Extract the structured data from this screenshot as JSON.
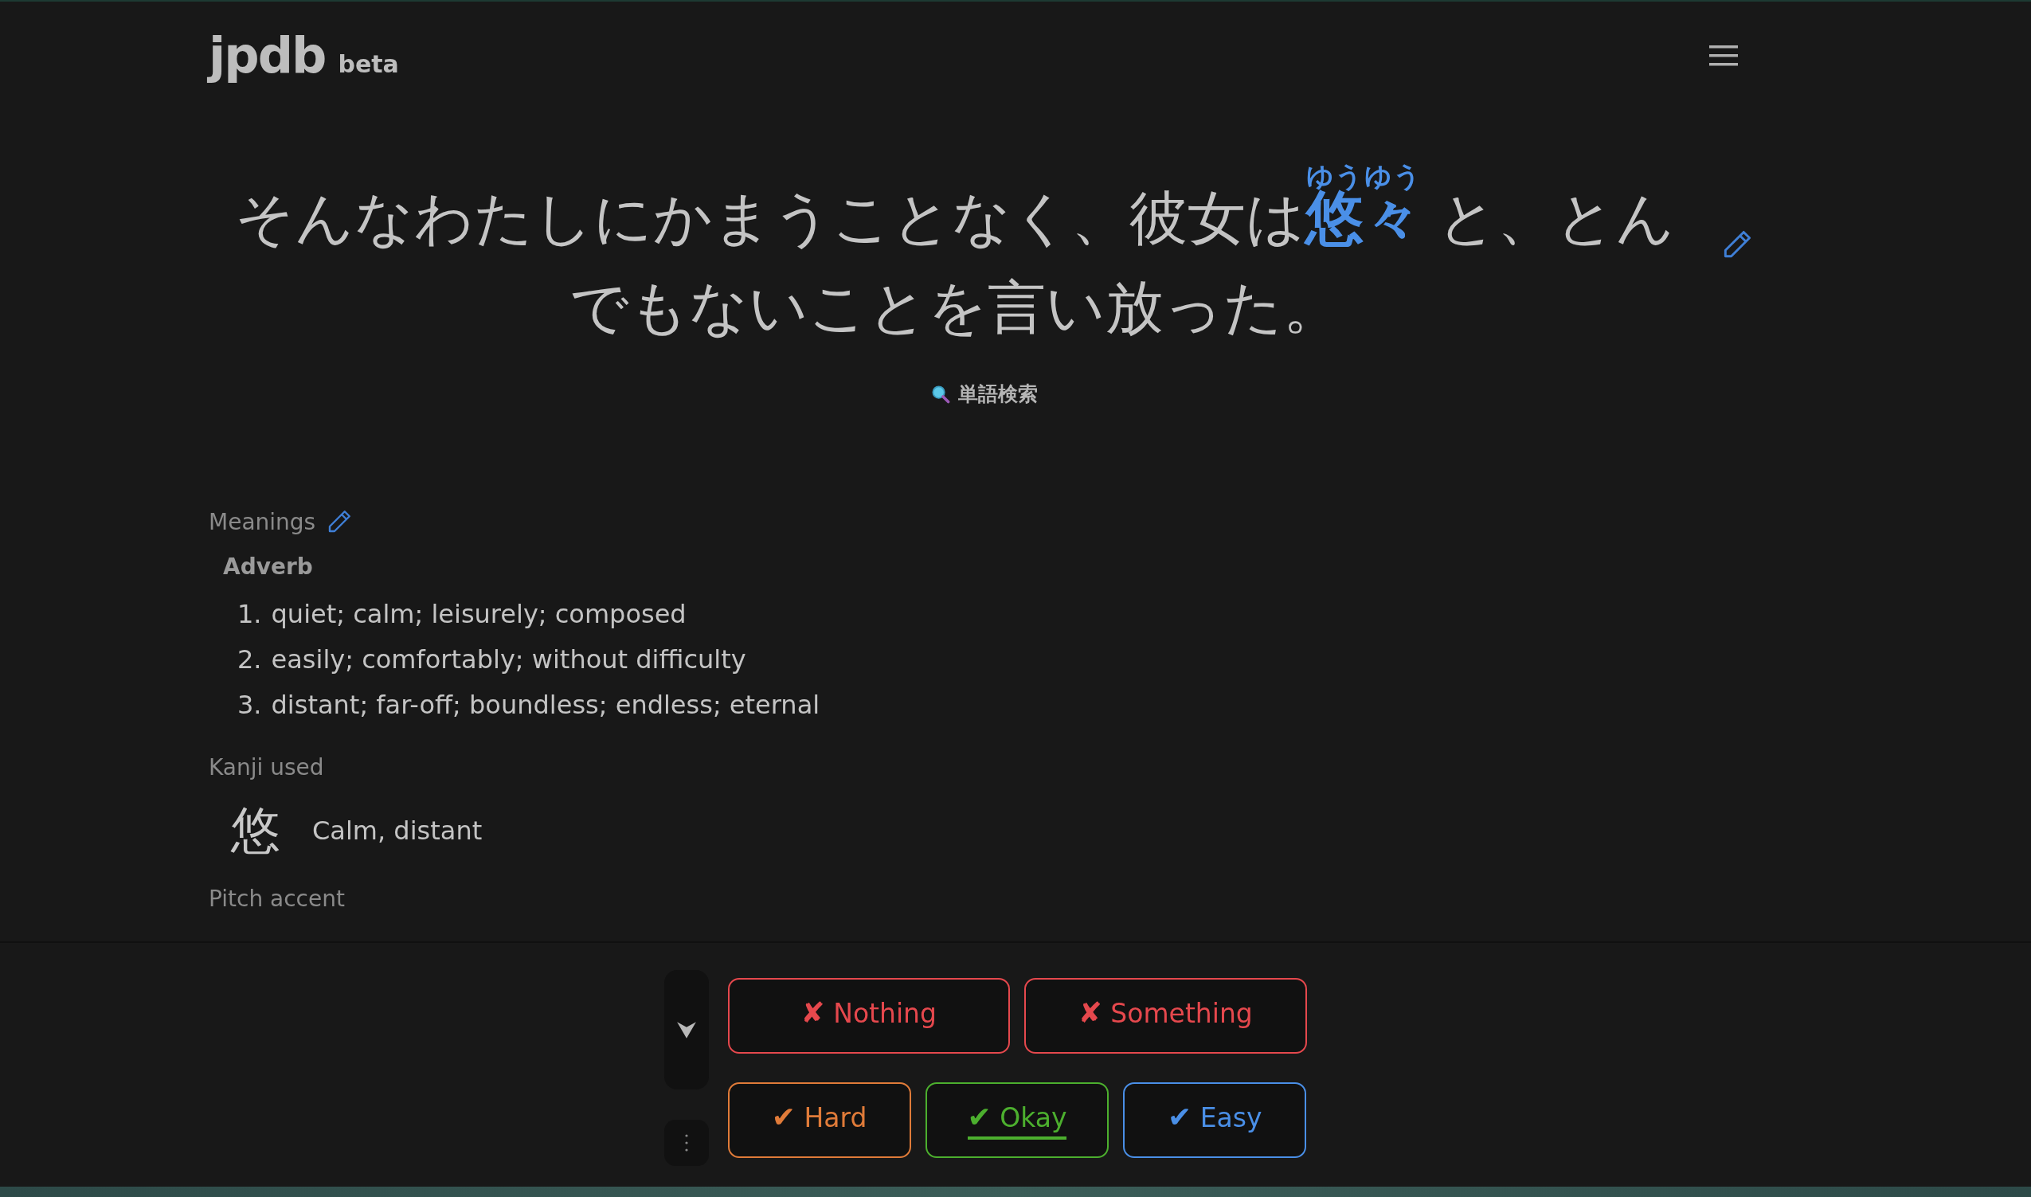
{
  "header": {
    "logo": "jpdb",
    "badge": "beta"
  },
  "sentence": {
    "before": "そんなわたしにかまうことなく、彼女は",
    "word": "悠々",
    "reading": "ゆうゆう",
    "after": "と、とんでもないことを言い放った。"
  },
  "lookup_link": "単語検索",
  "meanings": {
    "heading": "Meanings",
    "part_of_speech": "Adverb",
    "items": [
      {
        "number": "1.",
        "text": "quiet; calm; leisurely; composed"
      },
      {
        "number": "2.",
        "text": "easily; comfortably; without difficulty"
      },
      {
        "number": "3.",
        "text": "distant; far-off; boundless; endless; eternal"
      }
    ]
  },
  "kanji_used": {
    "heading": "Kanji used",
    "items": [
      {
        "kanji": "悠",
        "meaning": "Calm, distant"
      }
    ]
  },
  "pitch_accent": {
    "heading": "Pitch accent"
  },
  "answer_rows": [
    [
      {
        "kind": "fail",
        "mark": "✘",
        "label": "Nothing",
        "color": "#e5484d",
        "selected": false
      },
      {
        "kind": "fail",
        "mark": "✘",
        "label": "Something",
        "color": "#e5484d",
        "selected": false
      }
    ],
    [
      {
        "kind": "pass",
        "mark": "✔",
        "label": "Hard",
        "color": "#e07b39",
        "selected": false
      },
      {
        "kind": "pass",
        "mark": "✔",
        "label": "Okay",
        "color": "#4caf2e",
        "selected": true
      },
      {
        "kind": "pass",
        "mark": "✔",
        "label": "Easy",
        "color": "#4a8fe7",
        "selected": false
      }
    ]
  ]
}
